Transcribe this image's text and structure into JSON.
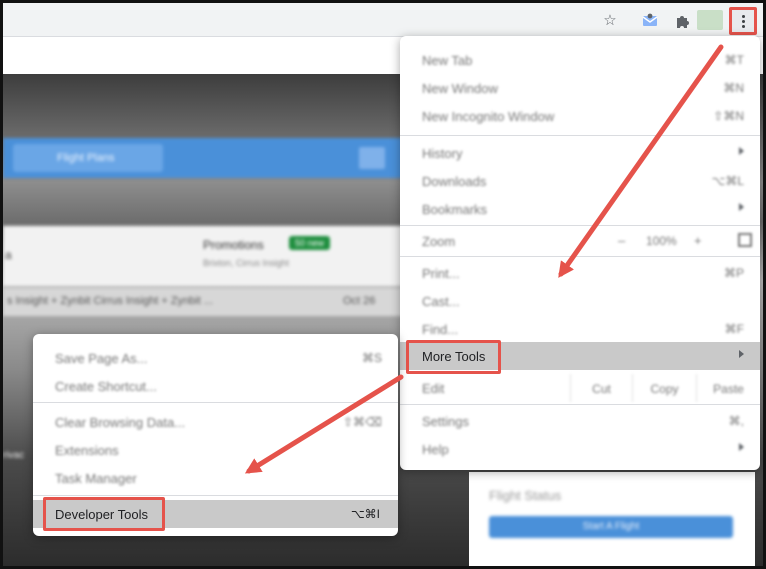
{
  "browser": {
    "icons": [
      "star-icon",
      "mail-extension-icon",
      "puzzle-icon",
      "kebab-menu-icon"
    ]
  },
  "background": {
    "bar_button": "Flight Plans",
    "promotions": "Promotions",
    "promo_badge": "50 new",
    "promo_sub": "Brixton, Cirrus Insight",
    "left_text": "a",
    "row_text": "s Insight + Zynbit   Cirrus Insight + Zynbit ...",
    "row_date": "Oct 26",
    "privacy": "rivac",
    "flight_status": "Flight Status",
    "start_flight": "Start A Flight"
  },
  "main_menu": {
    "items": [
      {
        "label": "New Tab",
        "shortcut": "⌘T"
      },
      {
        "label": "New Window",
        "shortcut": "⌘N"
      },
      {
        "label": "New Incognito Window",
        "shortcut": "⇧⌘N"
      },
      {
        "label": "History",
        "shortcut": ""
      },
      {
        "label": "Downloads",
        "shortcut": "⌥⌘L"
      },
      {
        "label": "Bookmarks",
        "shortcut": ""
      },
      {
        "label": "Print...",
        "shortcut": "⌘P"
      },
      {
        "label": "Cast...",
        "shortcut": ""
      },
      {
        "label": "Find...",
        "shortcut": "⌘F"
      },
      {
        "label": "More Tools",
        "shortcut": ""
      },
      {
        "label": "Settings",
        "shortcut": "⌘,"
      },
      {
        "label": "Help",
        "shortcut": ""
      }
    ],
    "zoom": {
      "label": "Zoom",
      "minus": "–",
      "value": "100%",
      "plus": "+"
    },
    "edit": {
      "label": "Edit",
      "cut": "Cut",
      "copy": "Copy",
      "paste": "Paste"
    }
  },
  "sub_menu": {
    "items": [
      {
        "label": "Save Page As...",
        "shortcut": "⌘S"
      },
      {
        "label": "Create Shortcut...",
        "shortcut": ""
      },
      {
        "label": "Clear Browsing Data...",
        "shortcut": "⇧⌘⌫"
      },
      {
        "label": "Extensions",
        "shortcut": ""
      },
      {
        "label": "Task Manager",
        "shortcut": ""
      },
      {
        "label": "Developer Tools",
        "shortcut": "⌥⌘I"
      }
    ]
  },
  "colors": {
    "highlight_box": "#e5534b",
    "hover": "#c9c9c9"
  }
}
